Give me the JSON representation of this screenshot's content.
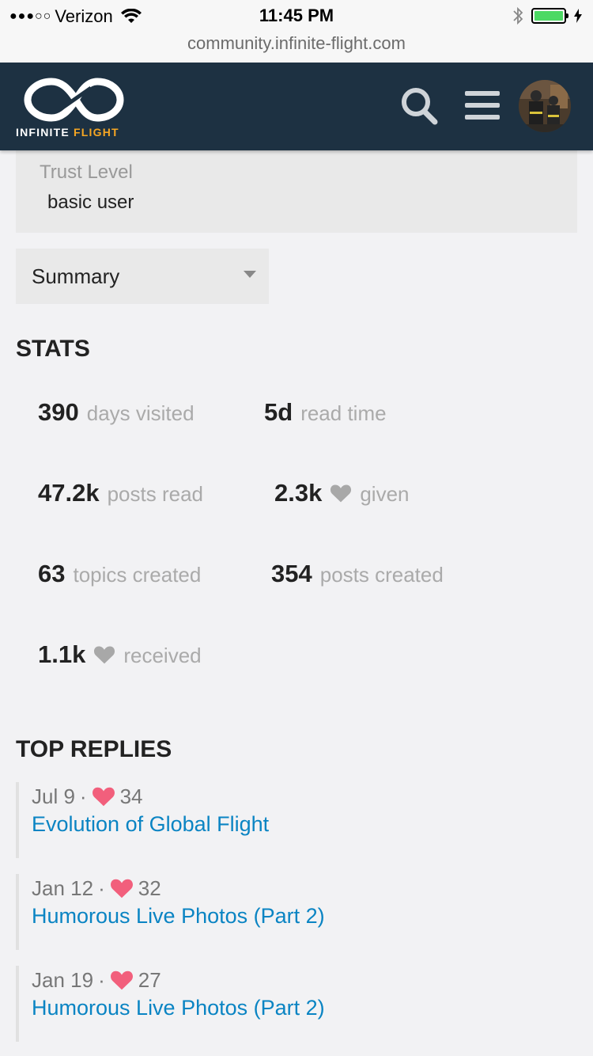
{
  "status_bar": {
    "signal": "●●●○○",
    "carrier": "Verizon",
    "time": "11:45 PM",
    "battery_level": 1.0
  },
  "url_bar": {
    "url": "community.infinite-flight.com"
  },
  "header": {
    "logo_text_1": "INFINITE ",
    "logo_text_2": "FLIGHT",
    "brand_color": "#1d3142",
    "accent_color": "#f6a623"
  },
  "profile": {
    "trust_label": "Trust Level",
    "trust_value": "basic user"
  },
  "dropdown": {
    "selected": "Summary"
  },
  "stats": {
    "title": "STATS",
    "items": [
      {
        "num": "390",
        "label": "days visited"
      },
      {
        "num": "5d",
        "label": "read time"
      },
      {
        "num": "47.2k",
        "label": "posts read"
      },
      {
        "num": "2.3k",
        "label": "given",
        "icon": "heart-icon"
      },
      {
        "num": "63",
        "label": "topics created"
      },
      {
        "num": "354",
        "label": "posts created"
      },
      {
        "num": "1.1k",
        "label": "received",
        "icon": "heart-icon"
      }
    ]
  },
  "top_replies": {
    "title": "TOP REPLIES",
    "items": [
      {
        "date": "Jul 9",
        "sep": "·",
        "likes": "34",
        "title": "Evolution of Global Flight"
      },
      {
        "date": "Jan 12",
        "sep": "·",
        "likes": "32",
        "title": "Humorous Live Photos (Part 2)"
      },
      {
        "date": "Jan 19",
        "sep": "·",
        "likes": "27",
        "title": "Humorous Live Photos (Part 2)"
      }
    ]
  },
  "colors": {
    "link": "#0a84c3",
    "like_heart": "#f25f7c",
    "muted_heart": "#a8a8a8"
  }
}
